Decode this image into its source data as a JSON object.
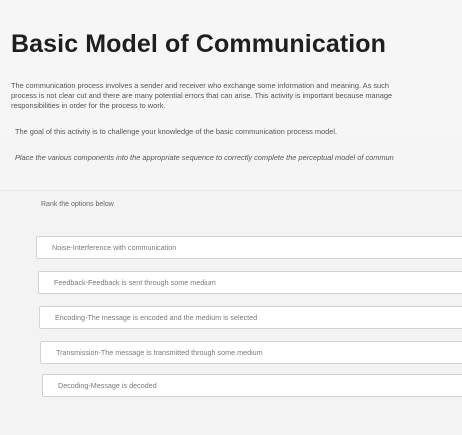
{
  "page": {
    "title": "Basic Model of Communication",
    "intro_line1": "The communication process involves a sender and receiver who exchange some information and meaning. As such",
    "intro_line2": "process is not clear cut and there are many potential errors that can arise. This activity is important because manage",
    "intro_line3": "responsibilities in order for the process to work.",
    "goal": "The goal of this activity is to challenge your knowledge of the basic communication process model.",
    "instruction": "Place the various components into the appropriate sequence to correctly complete the perceptual model of commun"
  },
  "ranking": {
    "label": "Rank the options below",
    "items": [
      "Noise-Interference with communication",
      "Feedback-Feedback is sent through some medium",
      "Encoding-The message is encoded and the medium is selected",
      "Transmission-The message is transmitted through some medium",
      "Decoding-Message is decoded"
    ]
  }
}
